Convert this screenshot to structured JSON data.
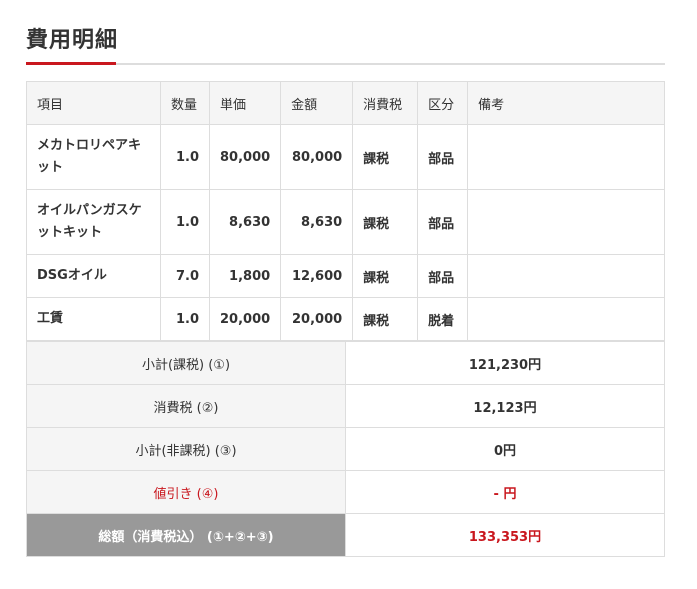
{
  "page": {
    "title": "費用明細"
  },
  "detail": {
    "headers": [
      "項目",
      "数量",
      "単価",
      "金額",
      "消費税",
      "区分",
      "備考"
    ],
    "rows": [
      {
        "item": "メカトロリペアキット",
        "qty": "1.0",
        "unit": "80,000",
        "amount": "80,000",
        "tax": "課税",
        "category": "部品",
        "note": ""
      },
      {
        "item": "オイルパンガスケットキット",
        "qty": "1.0",
        "unit": "8,630",
        "amount": "8,630",
        "tax": "課税",
        "category": "部品",
        "note": ""
      },
      {
        "item": "DSGオイル",
        "qty": "7.0",
        "unit": "1,800",
        "amount": "12,600",
        "tax": "課税",
        "category": "部品",
        "note": ""
      },
      {
        "item": "工賃",
        "qty": "1.0",
        "unit": "20,000",
        "amount": "20,000",
        "tax": "課税",
        "category": "脱着",
        "note": ""
      }
    ]
  },
  "summary": {
    "subtotal_taxable": {
      "label": "小計(課税) (①)",
      "value": "121,230円"
    },
    "consumption_tax": {
      "label": "消費税 (②)",
      "value": "12,123円"
    },
    "subtotal_nontaxable": {
      "label": "小計(非課税) (③)",
      "value": "0円"
    },
    "discount": {
      "label": "値引き (④)",
      "value": "- 円"
    },
    "total": {
      "label": "総額（消費税込） (①+②+③)",
      "value": "133,353円"
    }
  },
  "colors": {
    "accent": "#c9171e",
    "header_bg": "#f5f5f5",
    "total_bg": "#999999",
    "border": "#dddddd"
  }
}
